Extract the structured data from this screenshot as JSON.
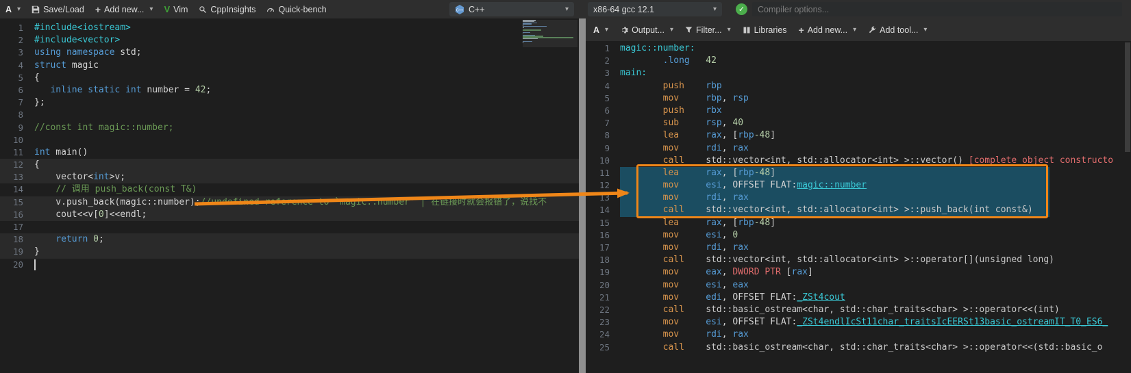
{
  "topbar": {
    "font": "A",
    "save_load": "Save/Load",
    "add_new": "Add new...",
    "vim": "Vim",
    "cppinsights": "CppInsights",
    "quickbench": "Quick-bench",
    "language": "C++",
    "compiler": "x86-64 gcc 12.1",
    "options_placeholder": "Compiler options..."
  },
  "asm_toolbar": {
    "font": "A",
    "output": "Output...",
    "filter": "Filter...",
    "libraries": "Libraries",
    "add_new": "Add new...",
    "add_tool": "Add tool..."
  },
  "editor": {
    "highlighted_lines": [
      12,
      13,
      15,
      16,
      18,
      19
    ],
    "cursor_line": 20,
    "lines": [
      [
        [
          "inc",
          "#include<iostream>"
        ]
      ],
      [
        [
          "inc",
          "#include<vector>"
        ]
      ],
      [
        [
          "kw",
          "using"
        ],
        [
          "pl",
          " "
        ],
        [
          "kw",
          "namespace"
        ],
        [
          "pl",
          " std;"
        ]
      ],
      [
        [
          "kw",
          "struct"
        ],
        [
          "pl",
          " magic"
        ]
      ],
      [
        [
          "pl",
          "{"
        ]
      ],
      [
        [
          "pl",
          "   "
        ],
        [
          "kw",
          "inline"
        ],
        [
          "pl",
          " "
        ],
        [
          "kw",
          "static"
        ],
        [
          "pl",
          " "
        ],
        [
          "kw",
          "int"
        ],
        [
          "pl",
          " number = "
        ],
        [
          "num",
          "42"
        ],
        [
          "pl",
          ";"
        ]
      ],
      [
        [
          "pl",
          "};"
        ]
      ],
      [],
      [
        [
          "com",
          "//const int magic::number;"
        ]
      ],
      [],
      [
        [
          "kw",
          "int"
        ],
        [
          "pl",
          " main()"
        ]
      ],
      [
        [
          "pl",
          "{"
        ]
      ],
      [
        [
          "pl",
          "    vector<"
        ],
        [
          "kw",
          "int"
        ],
        [
          "pl",
          ">v;"
        ]
      ],
      [
        [
          "pl",
          "    "
        ],
        [
          "com",
          "// 调用 push_back(const T&)"
        ]
      ],
      [
        [
          "pl",
          "    v.push_back(magic::number);"
        ],
        [
          "com",
          "//undefined reference to `magic::number' | 在链接时就会报错了，说找不"
        ]
      ],
      [
        [
          "pl",
          "    cout<<v["
        ],
        [
          "num",
          "0"
        ],
        [
          "pl",
          "]<<endl;"
        ]
      ],
      [],
      [
        [
          "pl",
          "    "
        ],
        [
          "kw",
          "return"
        ],
        [
          "pl",
          " "
        ],
        [
          "num",
          "0"
        ],
        [
          "pl",
          ";"
        ]
      ],
      [
        [
          "pl",
          "}"
        ]
      ],
      []
    ]
  },
  "assembly": {
    "selected_lines": [
      11,
      12,
      13,
      14
    ],
    "lines": [
      [
        [
          "lbl",
          "magic::number:"
        ]
      ],
      [
        [
          "pl",
          "        "
        ],
        [
          "dir",
          ".long"
        ],
        [
          "pl",
          "   "
        ],
        [
          "num",
          "42"
        ]
      ],
      [
        [
          "lbl",
          "main:"
        ]
      ],
      [
        [
          "pl",
          "        "
        ],
        [
          "op",
          "push"
        ],
        [
          "pl",
          "    "
        ],
        [
          "reg",
          "rbp"
        ]
      ],
      [
        [
          "pl",
          "        "
        ],
        [
          "op",
          "mov"
        ],
        [
          "pl",
          "     "
        ],
        [
          "reg",
          "rbp"
        ],
        [
          "pl",
          ", "
        ],
        [
          "reg",
          "rsp"
        ]
      ],
      [
        [
          "pl",
          "        "
        ],
        [
          "op",
          "push"
        ],
        [
          "pl",
          "    "
        ],
        [
          "reg",
          "rbx"
        ]
      ],
      [
        [
          "pl",
          "        "
        ],
        [
          "op",
          "sub"
        ],
        [
          "pl",
          "     "
        ],
        [
          "reg",
          "rsp"
        ],
        [
          "pl",
          ", "
        ],
        [
          "num",
          "40"
        ]
      ],
      [
        [
          "pl",
          "        "
        ],
        [
          "op",
          "lea"
        ],
        [
          "pl",
          "     "
        ],
        [
          "reg",
          "rax"
        ],
        [
          "pl",
          ", ["
        ],
        [
          "reg",
          "rbp"
        ],
        [
          "num",
          "-48"
        ],
        [
          "pl",
          "]"
        ]
      ],
      [
        [
          "pl",
          "        "
        ],
        [
          "op",
          "mov"
        ],
        [
          "pl",
          "     "
        ],
        [
          "reg",
          "rdi"
        ],
        [
          "pl",
          ", "
        ],
        [
          "reg",
          "rax"
        ]
      ],
      [
        [
          "pl",
          "        "
        ],
        [
          "op",
          "call"
        ],
        [
          "pl",
          "    "
        ],
        [
          "fn",
          "std::vector<int, std::allocator<int> >::vector() "
        ],
        [
          "red",
          "[complete object constructo"
        ]
      ],
      [
        [
          "pl",
          "        "
        ],
        [
          "op",
          "lea"
        ],
        [
          "pl",
          "     "
        ],
        [
          "reg",
          "rax"
        ],
        [
          "pl",
          ", ["
        ],
        [
          "reg",
          "rbp"
        ],
        [
          "num",
          "-48"
        ],
        [
          "pl",
          "]"
        ]
      ],
      [
        [
          "pl",
          "        "
        ],
        [
          "op",
          "mov"
        ],
        [
          "pl",
          "     "
        ],
        [
          "reg",
          "esi"
        ],
        [
          "pl",
          ", OFFSET FLAT:"
        ],
        [
          "link",
          "magic::number"
        ]
      ],
      [
        [
          "pl",
          "        "
        ],
        [
          "op",
          "mov"
        ],
        [
          "pl",
          "     "
        ],
        [
          "reg",
          "rdi"
        ],
        [
          "pl",
          ", "
        ],
        [
          "reg",
          "rax"
        ]
      ],
      [
        [
          "pl",
          "        "
        ],
        [
          "op",
          "call"
        ],
        [
          "pl",
          "    "
        ],
        [
          "fn",
          "std::vector<int, std::allocator<int> >::push_back(int const&)"
        ]
      ],
      [
        [
          "pl",
          "        "
        ],
        [
          "op",
          "lea"
        ],
        [
          "pl",
          "     "
        ],
        [
          "reg",
          "rax"
        ],
        [
          "pl",
          ", ["
        ],
        [
          "reg",
          "rbp"
        ],
        [
          "num",
          "-48"
        ],
        [
          "pl",
          "]"
        ]
      ],
      [
        [
          "pl",
          "        "
        ],
        [
          "op",
          "mov"
        ],
        [
          "pl",
          "     "
        ],
        [
          "reg",
          "esi"
        ],
        [
          "pl",
          ", "
        ],
        [
          "num",
          "0"
        ]
      ],
      [
        [
          "pl",
          "        "
        ],
        [
          "op",
          "mov"
        ],
        [
          "pl",
          "     "
        ],
        [
          "reg",
          "rdi"
        ],
        [
          "pl",
          ", "
        ],
        [
          "reg",
          "rax"
        ]
      ],
      [
        [
          "pl",
          "        "
        ],
        [
          "op",
          "call"
        ],
        [
          "pl",
          "    "
        ],
        [
          "fn",
          "std::vector<int, std::allocator<int> >::operator[](unsigned long)"
        ]
      ],
      [
        [
          "pl",
          "        "
        ],
        [
          "op",
          "mov"
        ],
        [
          "pl",
          "     "
        ],
        [
          "reg",
          "eax"
        ],
        [
          "pl",
          ", "
        ],
        [
          "red",
          "DWORD PTR"
        ],
        [
          "pl",
          " ["
        ],
        [
          "reg",
          "rax"
        ],
        [
          "pl",
          "]"
        ]
      ],
      [
        [
          "pl",
          "        "
        ],
        [
          "op",
          "mov"
        ],
        [
          "pl",
          "     "
        ],
        [
          "reg",
          "esi"
        ],
        [
          "pl",
          ", "
        ],
        [
          "reg",
          "eax"
        ]
      ],
      [
        [
          "pl",
          "        "
        ],
        [
          "op",
          "mov"
        ],
        [
          "pl",
          "     "
        ],
        [
          "reg",
          "edi"
        ],
        [
          "pl",
          ", OFFSET FLAT:"
        ],
        [
          "link",
          "_ZSt4cout"
        ]
      ],
      [
        [
          "pl",
          "        "
        ],
        [
          "op",
          "call"
        ],
        [
          "pl",
          "    "
        ],
        [
          "fn",
          "std::basic_ostream<char, std::char_traits<char> >::operator<<(int)"
        ]
      ],
      [
        [
          "pl",
          "        "
        ],
        [
          "op",
          "mov"
        ],
        [
          "pl",
          "     "
        ],
        [
          "reg",
          "esi"
        ],
        [
          "pl",
          ", OFFSET FLAT:"
        ],
        [
          "link",
          "_ZSt4endlIcSt11char_traitsIcEERSt13basic_ostreamIT_T0_ES6_"
        ]
      ],
      [
        [
          "pl",
          "        "
        ],
        [
          "op",
          "mov"
        ],
        [
          "pl",
          "     "
        ],
        [
          "reg",
          "rdi"
        ],
        [
          "pl",
          ", "
        ],
        [
          "reg",
          "rax"
        ]
      ],
      [
        [
          "pl",
          "        "
        ],
        [
          "op",
          "call"
        ],
        [
          "pl",
          "    "
        ],
        [
          "fn",
          "std::basic_ostream<char, std::char_traits<char> >::operator<<(std::basic_o"
        ]
      ]
    ]
  },
  "annotation": {
    "highlight_color": "#ef8618"
  }
}
